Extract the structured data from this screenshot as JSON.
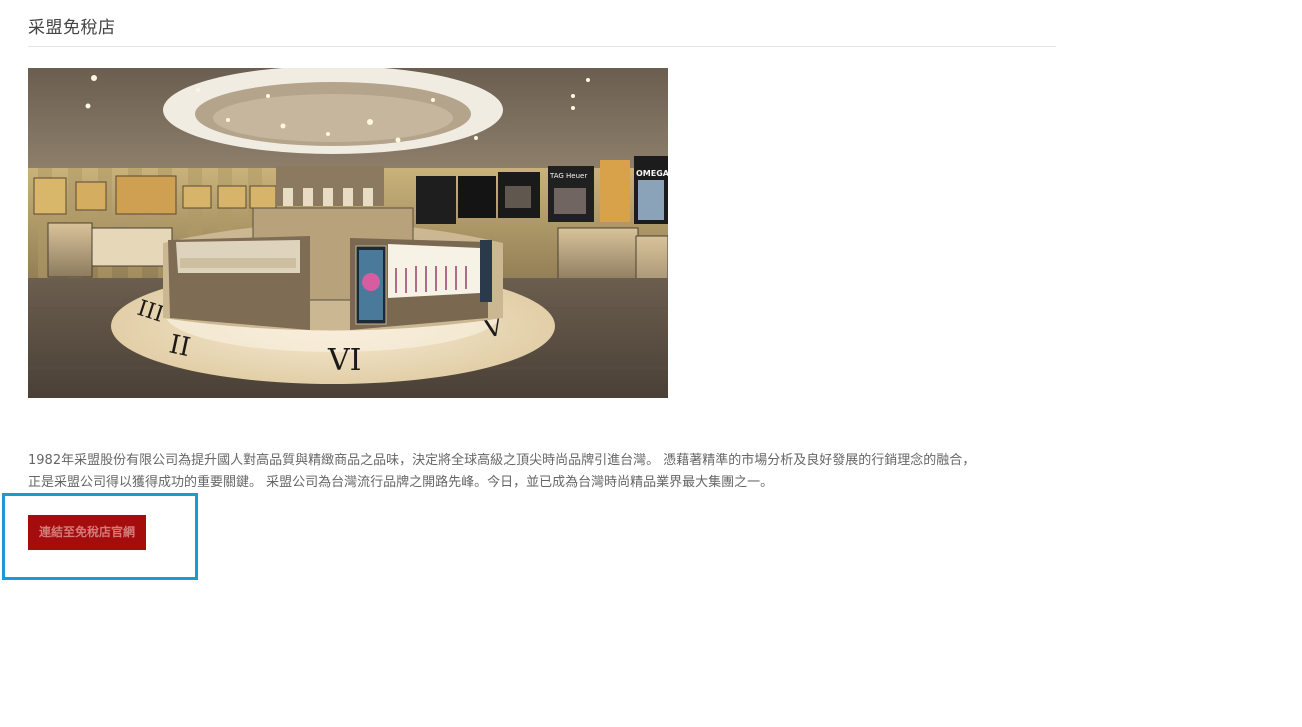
{
  "header": {
    "title": "采盟免稅店"
  },
  "main": {
    "image_alt": "采盟免稅店 store interior",
    "description_line1": "1982年采盟股份有限公司為提升國人對高品質與精緻商品之品味，決定將全球高級之頂尖時尚品牌引進台灣。 憑藉著精準的市場分析及良好發展的行銷理念的融合，",
    "description_line2": "正是采盟公司得以獲得成功的重要關鍵。 采盟公司為台灣流行品牌之開路先峰。今日，並已成為台灣時尚精品業界最大集團之一。",
    "link_button_label": "連結至免稅店官網"
  },
  "store_image_text": {
    "numeral_left": "III",
    "numeral_mid_left": "II",
    "numeral_center": "VI",
    "numeral_right": "V",
    "brand_tag": "TAG Heuer",
    "brand_omega": "OMEGA"
  },
  "colors": {
    "button_bg": "#a50c0c",
    "highlight_border": "#1d9ad6",
    "text": "#666666"
  }
}
